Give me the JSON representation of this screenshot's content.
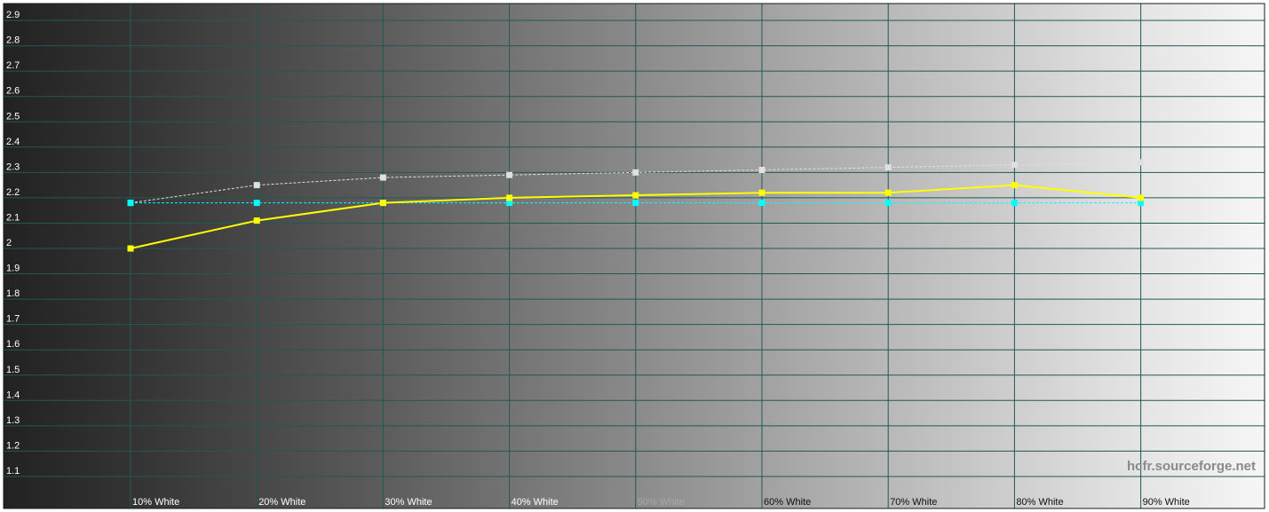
{
  "chart_data": {
    "type": "line",
    "title": "",
    "xlabel": "",
    "ylabel": "",
    "categories": [
      "10% White",
      "20% White",
      "30% White",
      "40% White",
      "50% White",
      "60% White",
      "70% White",
      "80% White",
      "90% White"
    ],
    "y_ticks": [
      "2.9",
      "2.8",
      "2.7",
      "2.6",
      "2.5",
      "2.4",
      "2.3",
      "2.2",
      "2.1",
      "2",
      "1.9",
      "1.8",
      "1.7",
      "1.6",
      "1.5",
      "1.4",
      "1.3",
      "1.2",
      "1.1"
    ],
    "ylim": [
      1.02,
      2.98
    ],
    "grid": true,
    "background": "grayscale gradient from dark (left) to white (right)",
    "series": [
      {
        "color": "#ffff00",
        "style": "solid",
        "values": [
          2.0,
          2.11,
          2.18,
          2.2,
          2.21,
          2.22,
          2.22,
          2.25,
          2.2
        ]
      },
      {
        "color": "#00ffff",
        "style": "dashed",
        "values": [
          2.18,
          2.18,
          2.18,
          2.18,
          2.18,
          2.18,
          2.18,
          2.18,
          2.18
        ]
      },
      {
        "color": "#e0e0e0",
        "style": "dashed",
        "values": [
          2.18,
          2.25,
          2.28,
          2.29,
          2.3,
          2.31,
          2.32,
          2.33,
          2.34
        ]
      }
    ],
    "grid_color": "#1f5a55"
  },
  "watermark": "hcfr.sourceforge.net"
}
